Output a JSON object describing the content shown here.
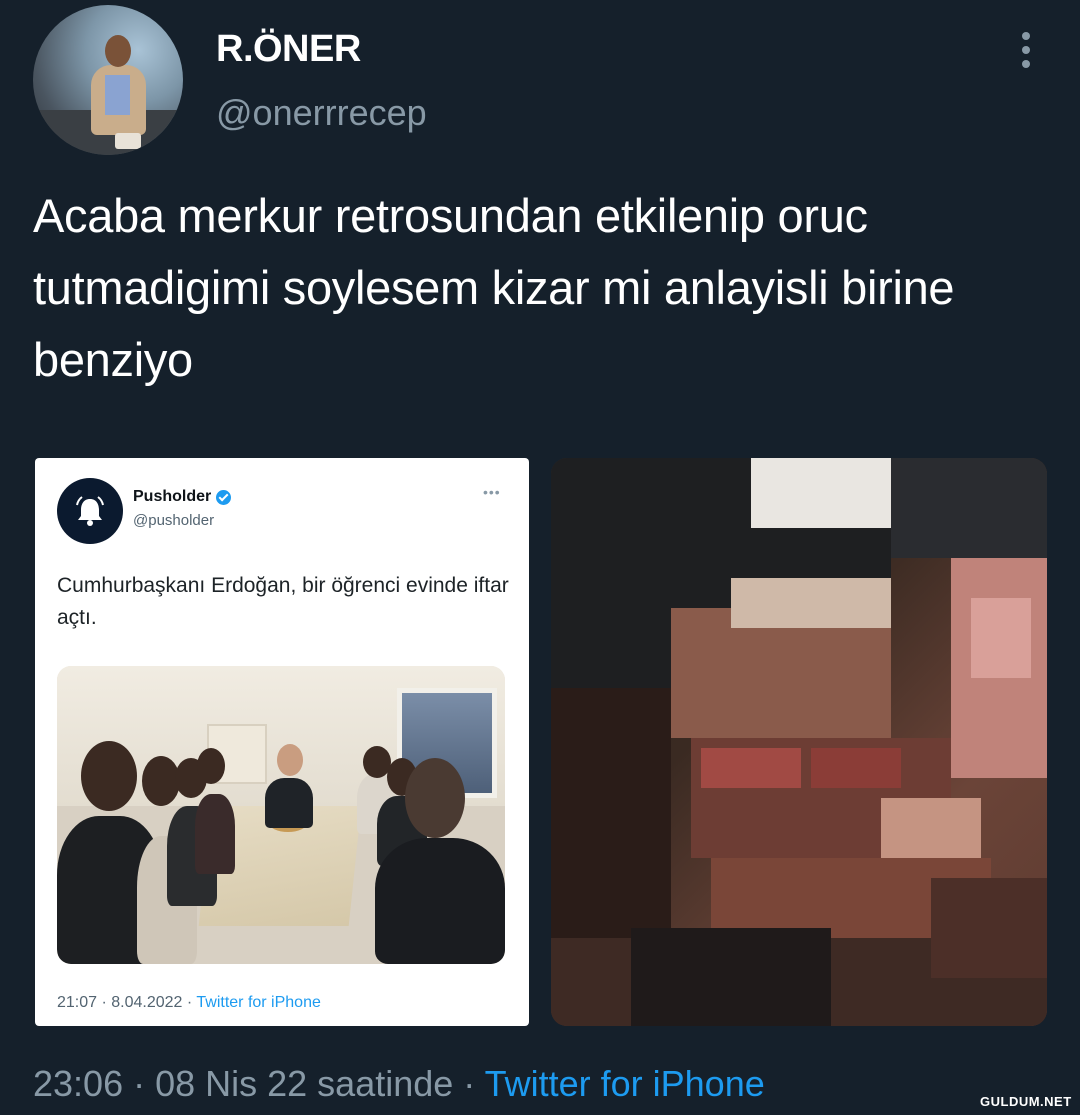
{
  "author": {
    "display_name": "R.ÖNER",
    "username": "@onerrrecep"
  },
  "tweet": {
    "text": "Acaba merkur retrosundan etkilenip oruc tutmadigimi soylesem kizar mi anlayisli birine benziyo",
    "timestamp": "23:06 · 08 Nis 22 saatinde · ",
    "source": "Twitter for iPhone"
  },
  "embedded_tweet": {
    "name": "Pusholder",
    "handle": "@pusholder",
    "text": "Cumhurbaşkanı Erdoğan, bir öğrenci evinde iftar açtı.",
    "timestamp": "21:07 · 8.04.2022 · ",
    "source": "Twitter for iPhone"
  },
  "watermark": "GULDUM.NET",
  "colors": {
    "background": "#15202b",
    "secondary_text": "#8899a6",
    "link": "#1d9bf0"
  },
  "icons": {
    "more": "more-vertical-icon",
    "verified": "verified-badge-icon",
    "bell": "bell-icon"
  }
}
